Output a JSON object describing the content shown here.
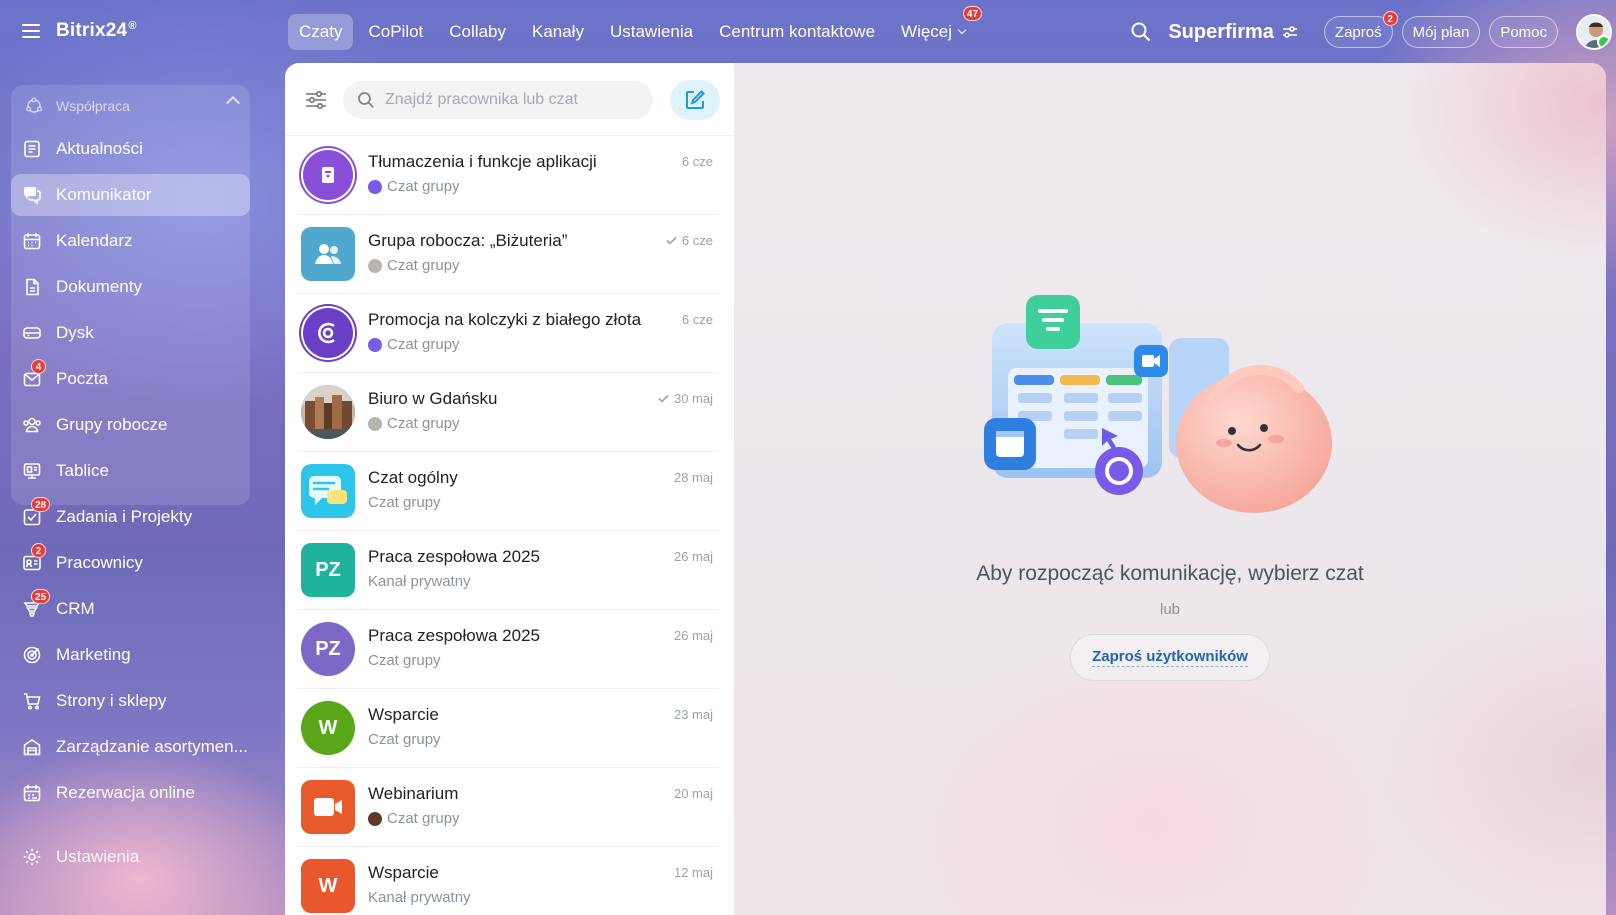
{
  "app": {
    "brand": "Bitrix24",
    "brand_mark": "®"
  },
  "sidebar": {
    "group_label": "Współpraca",
    "items": [
      {
        "label": "Aktualności",
        "icon": "news-icon"
      },
      {
        "label": "Komunikator",
        "icon": "messenger-icon",
        "active": true
      },
      {
        "label": "Kalendarz",
        "icon": "calendar-icon"
      },
      {
        "label": "Dokumenty",
        "icon": "document-icon"
      },
      {
        "label": "Dysk",
        "icon": "drive-icon"
      },
      {
        "label": "Poczta",
        "icon": "mail-icon",
        "badge": "4"
      },
      {
        "label": "Grupy robocze",
        "icon": "workgroups-icon"
      },
      {
        "label": "Tablice",
        "icon": "boards-icon"
      },
      {
        "label": "Zadania i Projekty",
        "icon": "tasks-icon",
        "badge": "28"
      },
      {
        "label": "Pracownicy",
        "icon": "employees-icon",
        "badge": "2"
      },
      {
        "label": "CRM",
        "icon": "crm-icon",
        "badge": "25"
      },
      {
        "label": "Marketing",
        "icon": "marketing-icon"
      },
      {
        "label": "Strony i sklepy",
        "icon": "cart-icon"
      },
      {
        "label": "Zarządzanie asortymen...",
        "icon": "inventory-icon"
      },
      {
        "label": "Rezerwacja online",
        "icon": "booking-icon"
      }
    ],
    "settings_label": "Ustawienia"
  },
  "topnav": {
    "tabs": [
      {
        "label": "Czaty",
        "active": true
      },
      {
        "label": "CoPilot"
      },
      {
        "label": "Collaby"
      },
      {
        "label": "Kanały"
      },
      {
        "label": "Ustawienia"
      },
      {
        "label": "Centrum kontaktowe"
      },
      {
        "label": "Więcej",
        "badge": "47"
      }
    ],
    "company": "Superfirma",
    "invite_label": "Zaproś",
    "invite_badge": "2",
    "plan_label": "Mój plan",
    "help_label": "Pomoc"
  },
  "chatlist": {
    "search_placeholder": "Znajdź pracownika lub czat",
    "chats": [
      {
        "title": "Tłumaczenia i funkcje aplikacji",
        "sub": "Czat grupy",
        "date": "6 cze",
        "avatar": "book-icon",
        "color": "#8a4fd8"
      },
      {
        "title": "Grupa robocza: „Biżuteria”",
        "sub": "Czat grupy",
        "date": "6 cze",
        "read": true,
        "avatar": "group-icon",
        "color": "#4fa9cf"
      },
      {
        "title": "Promocja na kolczyki z białego złota",
        "sub": "Czat grupy",
        "date": "6 cze",
        "avatar": "copilot-icon",
        "color": "#6b3fc7"
      },
      {
        "title": "Biuro w Gdańsku",
        "sub": "Czat grupy",
        "date": "30 maj",
        "read": true,
        "avatar": "photo-icon",
        "color": "#8a6a4c"
      },
      {
        "title": "Czat ogólny",
        "sub": "Czat grupy",
        "date": "28 maj",
        "avatar": "chat-bubble-icon",
        "color": "#29c6e8"
      },
      {
        "title": "Praca zespołowa 2025",
        "sub": "Kanał prywatny",
        "date": "26 maj",
        "initials": "PZ",
        "color": "#1fb39b"
      },
      {
        "title": "Praca zespołowa 2025",
        "sub": "Czat grupy",
        "date": "26 maj",
        "initials": "PZ",
        "color": "#7d68c8"
      },
      {
        "title": "Wsparcie",
        "sub": "Czat grupy",
        "date": "23 maj",
        "initials": "W",
        "color": "#5aa619"
      },
      {
        "title": "Webinarium",
        "sub": "Czat grupy",
        "date": "20 maj",
        "avatar": "video-icon",
        "color": "#e85a2c"
      },
      {
        "title": "Wsparcie",
        "sub": "Kanał prywatny",
        "date": "12 maj",
        "initials": "W",
        "color": "#e8582c"
      }
    ]
  },
  "main": {
    "empty_title": "Aby rozpocząć komunikację, wybierz czat",
    "or_label": "lub",
    "invite_users_label": "Zaproś użytkowników"
  }
}
